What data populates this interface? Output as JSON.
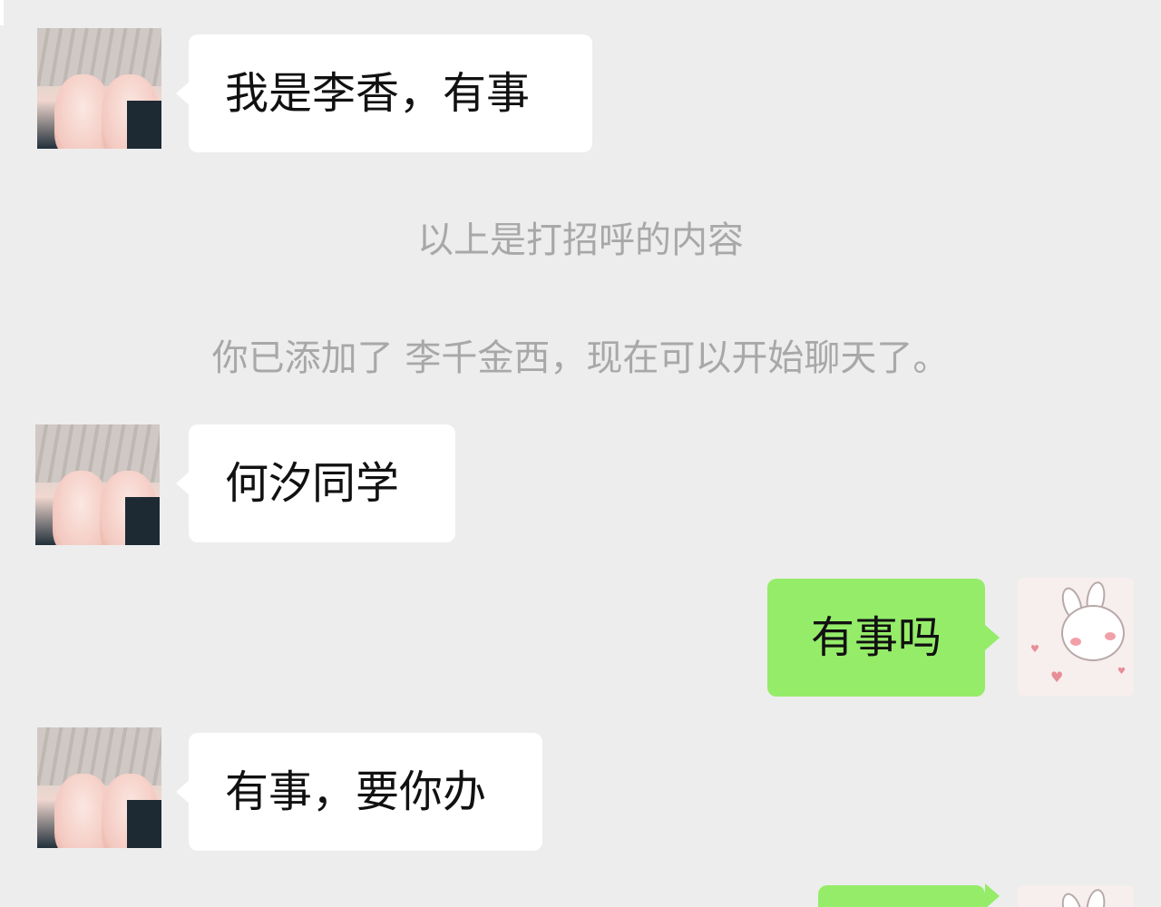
{
  "messages": [
    {
      "sender": "other",
      "text": "我是李香，有事"
    },
    {
      "sender": "other",
      "text": "何汐同学"
    },
    {
      "sender": "me",
      "text": "有事吗"
    },
    {
      "sender": "other",
      "text": "有事，要你办"
    }
  ],
  "system": {
    "greeting_note": "以上是打招呼的内容",
    "added_note": "你已添加了 李千金西，现在可以开始聊天了。"
  },
  "colors": {
    "background": "#ededed",
    "incoming_bubble": "#ffffff",
    "outgoing_bubble": "#95ec69",
    "system_text": "#a8a8a8"
  },
  "icons": {
    "contact_avatar": "anime-avatar",
    "self_avatar": "bunny-sticker-avatar"
  }
}
